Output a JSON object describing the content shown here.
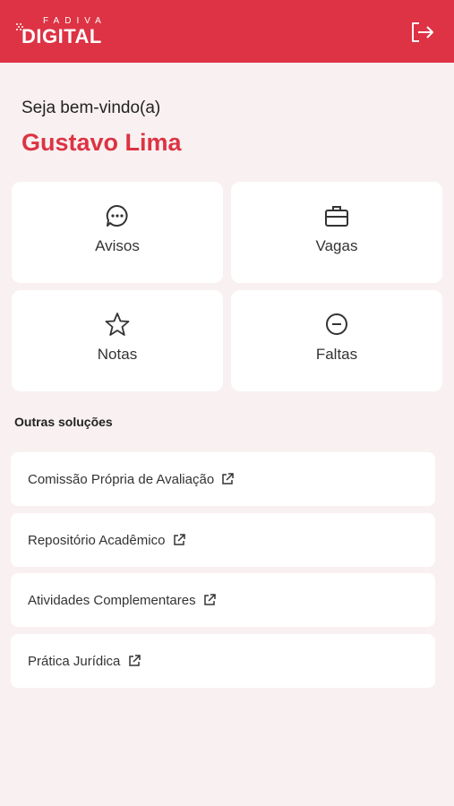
{
  "header": {
    "logo_top": "FADIVA",
    "logo_main": "DIGITAL",
    "logout_icon": "logout-icon",
    "bg_color": "#dd3344"
  },
  "greeting": {
    "welcome": "Seja bem-vindo(a)",
    "name": "Gustavo Lima"
  },
  "cards": [
    {
      "label": "Avisos",
      "icon": "chat-bubble-icon"
    },
    {
      "label": "Vagas",
      "icon": "briefcase-icon"
    },
    {
      "label": "Notas",
      "icon": "star-icon"
    },
    {
      "label": "Faltas",
      "icon": "minus-circle-icon"
    }
  ],
  "other_solutions": {
    "title": "Outras soluções",
    "items": [
      {
        "label": "Comissão Própria de Avaliação",
        "icon": "external-link-icon"
      },
      {
        "label": "Repositório Acadêmico",
        "icon": "external-link-icon"
      },
      {
        "label": "Atividades Complementares",
        "icon": "external-link-icon"
      },
      {
        "label": "Prática Jurídica",
        "icon": "external-link-icon"
      }
    ]
  },
  "colors": {
    "accent": "#dd3344",
    "background": "#f9f1f1",
    "card": "#ffffff"
  }
}
